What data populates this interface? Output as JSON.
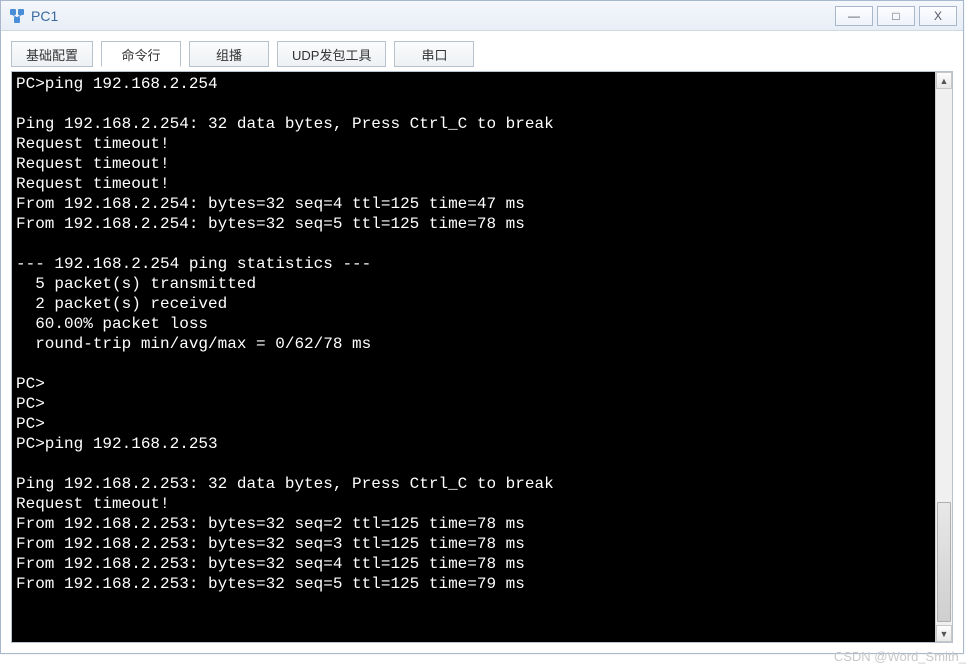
{
  "window": {
    "title": "PC1"
  },
  "tabs": {
    "t0": "基础配置",
    "t1": "命令行",
    "t2": "组播",
    "t3": "UDP发包工具",
    "t4": "串口"
  },
  "terminal": {
    "lines": [
      "PC>ping 192.168.2.254",
      "",
      "Ping 192.168.2.254: 32 data bytes, Press Ctrl_C to break",
      "Request timeout!",
      "Request timeout!",
      "Request timeout!",
      "From 192.168.2.254: bytes=32 seq=4 ttl=125 time=47 ms",
      "From 192.168.2.254: bytes=32 seq=5 ttl=125 time=78 ms",
      "",
      "--- 192.168.2.254 ping statistics ---",
      "  5 packet(s) transmitted",
      "  2 packet(s) received",
      "  60.00% packet loss",
      "  round-trip min/avg/max = 0/62/78 ms",
      "",
      "PC>",
      "PC>",
      "PC>",
      "PC>ping 192.168.2.253",
      "",
      "Ping 192.168.2.253: 32 data bytes, Press Ctrl_C to break",
      "Request timeout!",
      "From 192.168.2.253: bytes=32 seq=2 ttl=125 time=78 ms",
      "From 192.168.2.253: bytes=32 seq=3 ttl=125 time=78 ms",
      "From 192.168.2.253: bytes=32 seq=4 ttl=125 time=78 ms",
      "From 192.168.2.253: bytes=32 seq=5 ttl=125 time=79 ms"
    ]
  },
  "watermark": "CSDN @Word_Smith_"
}
